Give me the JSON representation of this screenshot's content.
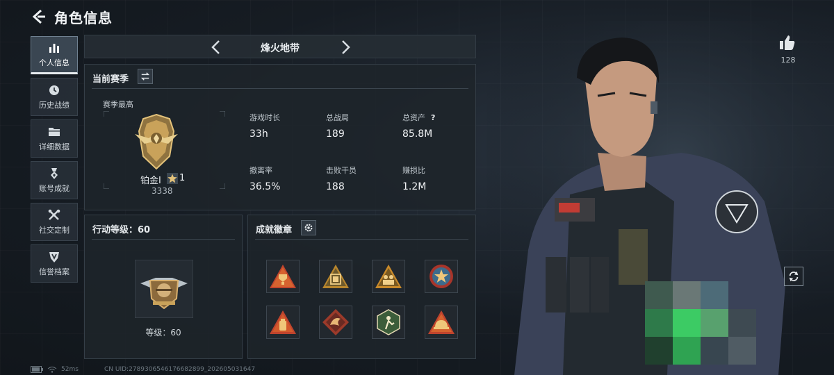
{
  "header": {
    "title": "角色信息"
  },
  "sidebar": {
    "items": [
      {
        "label": "个人信息",
        "icon": "bar-chart-icon",
        "active": true
      },
      {
        "label": "历史战绩",
        "icon": "clock-icon",
        "active": false
      },
      {
        "label": "详细数据",
        "icon": "folder-icon",
        "active": false
      },
      {
        "label": "账号成就",
        "icon": "medal-icon",
        "active": false
      },
      {
        "label": "社交定制",
        "icon": "tools-icon",
        "active": false
      },
      {
        "label": "信誉档案",
        "icon": "shield-icon",
        "active": false
      }
    ]
  },
  "mode": {
    "label": "烽火地带"
  },
  "season": {
    "title": "当前赛季",
    "best_label": "赛季最高",
    "rank_name": "铂金Ⅰ",
    "rank_level": "1",
    "rank_score": "3338",
    "stats": [
      {
        "label": "游戏时长",
        "value": "33h"
      },
      {
        "label": "总战局",
        "value": "189"
      },
      {
        "label": "总资产",
        "value": "85.8M",
        "help": "?"
      },
      {
        "label": "撤离率",
        "value": "36.5%"
      },
      {
        "label": "击败干员",
        "value": "188"
      },
      {
        "label": "赚损比",
        "value": "1.2M"
      }
    ]
  },
  "action_level": {
    "title": "行动等级：60",
    "level_text": "等级：60"
  },
  "badges": {
    "title": "成就徽章",
    "count": 8
  },
  "social": {
    "like_count": "128"
  },
  "footer": {
    "ping": "52ms",
    "uid": "CN UID:2789306546176682899_202605031647"
  },
  "colors": {
    "accent": "#e7ecef",
    "gold": "#c9a25a",
    "panel": "#1e242a"
  }
}
